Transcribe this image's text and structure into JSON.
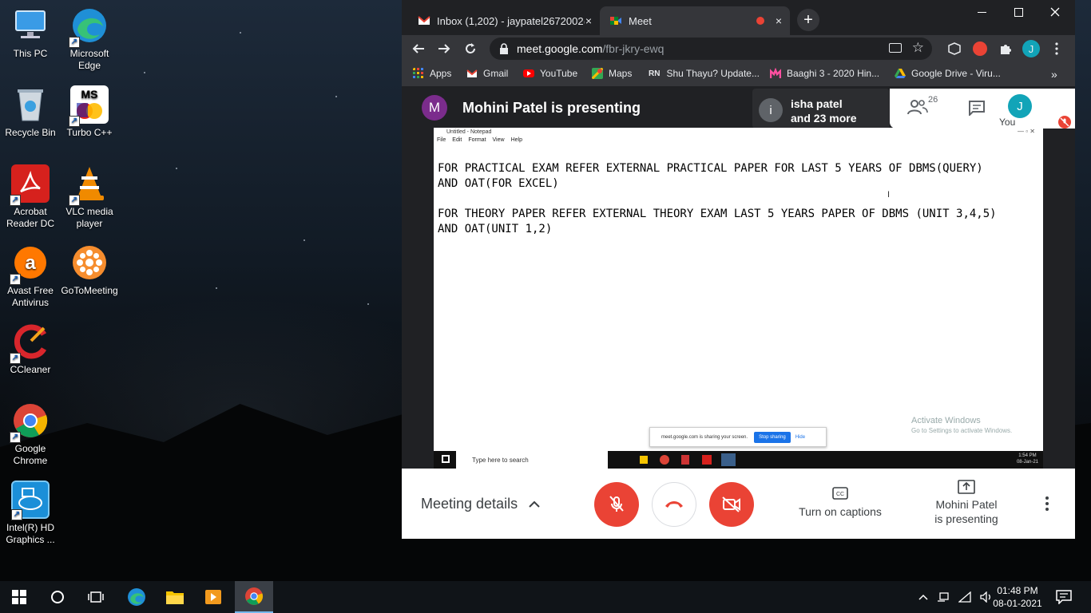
{
  "desktop": {
    "icons": [
      {
        "label": "This PC",
        "icon": "computer-icon"
      },
      {
        "label": "Microsoft Edge",
        "icon": "edge-icon"
      },
      {
        "label": "Recycle Bin",
        "icon": "recycle-bin-icon"
      },
      {
        "label": "Turbo C++",
        "icon": "turbo-cpp-icon"
      },
      {
        "label": "Acrobat Reader DC",
        "icon": "acrobat-icon"
      },
      {
        "label": "VLC media player",
        "icon": "vlc-icon"
      },
      {
        "label": "Avast Free Antivirus",
        "icon": "avast-icon"
      },
      {
        "label": "GoToMeeting",
        "icon": "gotomeeting-icon"
      },
      {
        "label": "CCleaner",
        "icon": "ccleaner-icon"
      },
      {
        "label": "Google Chrome",
        "icon": "chrome-icon"
      },
      {
        "label": "Intel(R) HD Graphics ...",
        "icon": "intel-icon"
      }
    ],
    "turbo_badge": "MS"
  },
  "browser": {
    "tabs": [
      {
        "label": "Inbox (1,202) - jaypatel2672002@",
        "icon": "gmail-icon"
      },
      {
        "label": "Meet",
        "icon": "meet-icon",
        "active": true
      }
    ],
    "close_glyph": "×",
    "new_tab_glyph": "+",
    "url_host": "meet.google.com",
    "url_path": "/fbr-jkry-ewq",
    "profile_initial": "J",
    "bookmarks": [
      {
        "label": "Apps",
        "color": "#4285f4"
      },
      {
        "label": "Gmail",
        "color": "#ea4335"
      },
      {
        "label": "YouTube",
        "color": "#ff0000"
      },
      {
        "label": "Maps",
        "color": "#34a853"
      },
      {
        "label": "Shu Thayu? Update...",
        "color": "#ffffff",
        "badge": "RN"
      },
      {
        "label": "Baaghi 3 - 2020 Hin...",
        "color": "#ff4fa0"
      },
      {
        "label": "Google Drive - Viru...",
        "color": "#fbbc04"
      }
    ]
  },
  "meet": {
    "presenter_initial": "M",
    "presenting_title": "Mohini Patel is presenting",
    "participant_initial": "i",
    "participant_name": "isha patel",
    "participant_more": "and 23 more",
    "people_count": "26",
    "you_label": "You",
    "you_initial": "J",
    "notepad": {
      "title": "Untitled - Notepad",
      "menu": [
        "File",
        "Edit",
        "Format",
        "View",
        "Help"
      ],
      "text": "FOR PRACTICAL EXAM REFER EXTERNAL PRACTICAL PAPER FOR LAST 5 YEARS OF DBMS(QUERY)\nAND OAT(FOR EXCEL)\n\nFOR THEORY PAPER REFER EXTERNAL THEORY EXAM LAST 5 YEARS PAPER OF DBMS (UNIT 3,4,5)\nAND OAT(UNIT 1,2)"
    },
    "activate_title": "Activate Windows",
    "activate_sub": "Go to Settings to activate Windows.",
    "share_text": "meet.google.com is sharing your screen.",
    "share_stop": "Stop sharing",
    "share_hide": "Hide",
    "inner_search": "Type here to search",
    "inner_time": "1:54 PM",
    "inner_date": "08-Jan-21",
    "meeting_details": "Meeting details",
    "captions": "Turn on captions",
    "presenting_line1": "Mohini Patel",
    "presenting_line2": "is presenting"
  },
  "taskbar": {
    "time": "01:48 PM",
    "date": "08-01-2021"
  }
}
